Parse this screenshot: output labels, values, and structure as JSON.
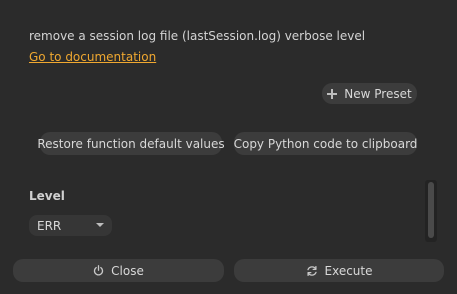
{
  "description": "remove a session log file (lastSession.log) verbose level",
  "doc_link": "Go to documentation",
  "presets": {
    "new_preset_label": "New Preset"
  },
  "actions": {
    "restore_label": "Restore function default values",
    "copy_python_label": "Copy Python code to clipboard"
  },
  "params": {
    "level": {
      "label": "Level",
      "value": "ERR"
    }
  },
  "footer": {
    "close_label": "Close",
    "execute_label": "Execute"
  },
  "icons": {
    "new_preset": "plus-icon",
    "close": "power-icon",
    "execute": "refresh-icon",
    "level_dropdown": "chevron-down-icon"
  },
  "colors": {
    "background": "#2b2b2b",
    "button": "#3c3c3c",
    "link": "#f0a830",
    "text": "#d6d6d6"
  }
}
